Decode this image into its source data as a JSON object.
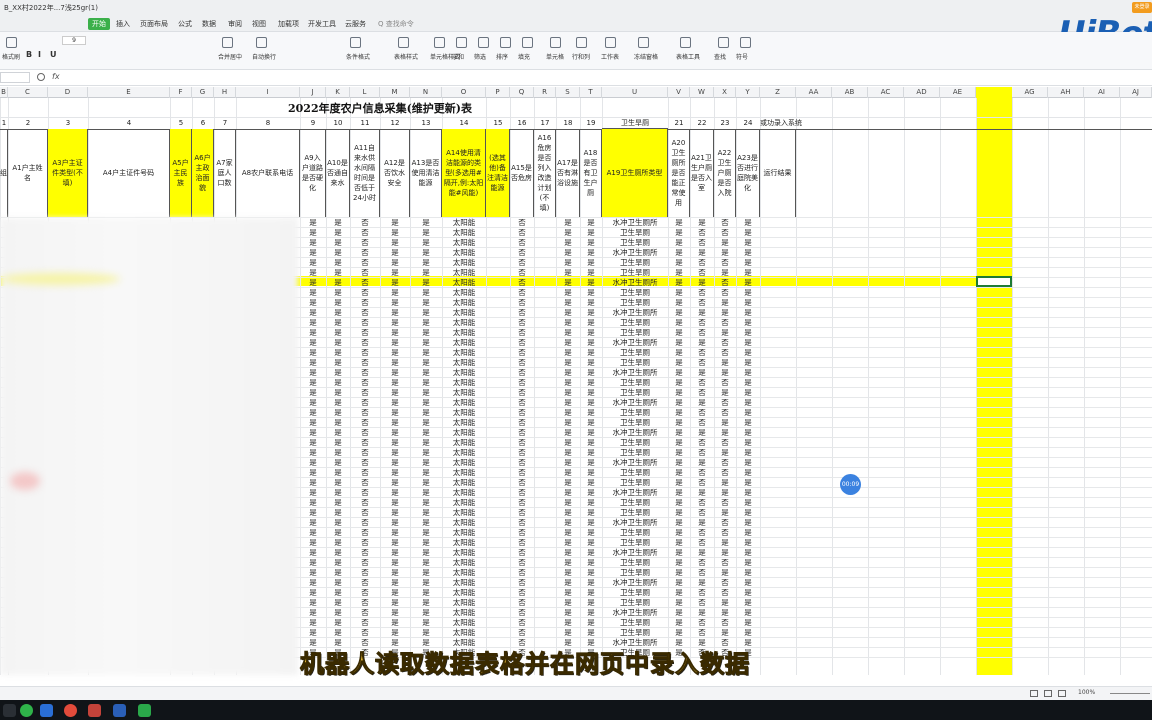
{
  "window": {
    "doc_tab": "B_XX村2022年...7浅25gr(1)",
    "corner_badge": "未登录"
  },
  "menu": {
    "items": [
      "开始",
      "插入",
      "页面布局",
      "公式",
      "数据",
      "审阅",
      "视图",
      "加载项",
      "开发工具",
      "云服务"
    ],
    "active": "开始",
    "search": "查找命令"
  },
  "ribbon": {
    "labels": [
      "格式刷",
      "合并居中",
      "自动换行",
      "条件格式",
      "表格样式",
      "单元格样式",
      "求和",
      "筛选",
      "排序",
      "填充",
      "单元格",
      "行和列",
      "工作表",
      "冻结窗格",
      "表格工具",
      "查找",
      "符号"
    ],
    "font_size": "9"
  },
  "formula_bar": {
    "name_box": "",
    "fx": "fx"
  },
  "logo": "UiBot",
  "columns": [
    "B",
    "C",
    "D",
    "E",
    "F",
    "G",
    "H",
    "I",
    "J",
    "K",
    "L",
    "M",
    "N",
    "O",
    "P",
    "Q",
    "R",
    "S",
    "T",
    "U",
    "V",
    "W",
    "X",
    "Y",
    "Z",
    "AA",
    "AB",
    "AC",
    "AD",
    "AE",
    "AF",
    "AG",
    "AH",
    "AI",
    "AJ"
  ],
  "sheet": {
    "title": "2022年度农户信息采集(维护更新)表",
    "number_row": [
      "1",
      "2",
      "3",
      "4",
      "5",
      "6",
      "7",
      "8",
      "9",
      "10",
      "11",
      "12",
      "13",
      "14",
      "15",
      "16",
      "17",
      "18",
      "19",
      "卫生旱厕",
      "21",
      "22",
      "23",
      "24",
      "或功录入系统"
    ],
    "headers": [
      {
        "text": "组",
        "yellow": false
      },
      {
        "text": "A1户主姓名",
        "yellow": false
      },
      {
        "text": "A3户主证件类型(不填)",
        "yellow": true
      },
      {
        "text": "A4户主证件号码",
        "yellow": false
      },
      {
        "text": "A5户主民族",
        "yellow": true
      },
      {
        "text": "A6户主政治面貌",
        "yellow": true
      },
      {
        "text": "A7家庭人口数",
        "yellow": false
      },
      {
        "text": "A8农户联系电话",
        "yellow": false
      },
      {
        "text": "A9入户道路是否硬化",
        "yellow": false
      },
      {
        "text": "A10是否通自来水",
        "yellow": false
      },
      {
        "text": "A11自来水供水间隔时间是否低于24小时",
        "yellow": false
      },
      {
        "text": "A12是否饮水安全",
        "yellow": false
      },
      {
        "text": "A13是否使用清洁能源",
        "yellow": false
      },
      {
        "text": "A14使用清洁能源的类型(多选用#隔开,例:太阳能#风能)",
        "yellow": true
      },
      {
        "text": "(选其他)备注清洁能源",
        "yellow": true
      },
      {
        "text": "A15是否危房",
        "yellow": false
      },
      {
        "text": "A16危房是否列入改造计划(不填)",
        "yellow": false
      },
      {
        "text": "A17是否有淋浴设施",
        "yellow": false
      },
      {
        "text": "A18是否有卫生户厕",
        "yellow": false
      },
      {
        "text": "A19卫生厕所类型",
        "yellow": true
      },
      {
        "text": "A20卫生厕所是否能正常使用",
        "yellow": false
      },
      {
        "text": "A21卫生户厕是否入室",
        "yellow": false
      },
      {
        "text": "A22卫生户厕是否入院",
        "yellow": false
      },
      {
        "text": "A23是否进行庭院美化",
        "yellow": false
      },
      {
        "text": "运行结果",
        "yellow": false
      }
    ],
    "row_pattern": [
      [
        "是",
        "是",
        "否",
        "是",
        "是",
        "太阳能",
        "",
        "否",
        "",
        "是",
        "是",
        "水冲卫生厕所",
        "是",
        "是",
        "否",
        "是"
      ],
      [
        "是",
        "是",
        "否",
        "是",
        "是",
        "太阳能",
        "",
        "否",
        "",
        "是",
        "是",
        "卫生旱厕",
        "是",
        "否",
        "否",
        "是"
      ],
      [
        "是",
        "是",
        "否",
        "是",
        "是",
        "太阳能",
        "",
        "否",
        "",
        "是",
        "是",
        "卫生旱厕",
        "是",
        "否",
        "是",
        "是"
      ],
      [
        "是",
        "是",
        "否",
        "是",
        "是",
        "太阳能",
        "",
        "否",
        "",
        "是",
        "是",
        "水冲卫生厕所",
        "是",
        "是",
        "是",
        "是"
      ],
      [
        "是",
        "是",
        "否",
        "是",
        "是",
        "太阳能",
        "",
        "否",
        "",
        "是",
        "是",
        "卫生旱厕",
        "是",
        "否",
        "否",
        "是"
      ],
      [
        "是",
        "是",
        "否",
        "是",
        "是",
        "太阳能",
        "",
        "否",
        "",
        "是",
        "是",
        "卫生旱厕",
        "是",
        "否",
        "是",
        "是"
      ]
    ],
    "row_count": 44
  },
  "timer": "00:09",
  "subtitle": "机器人读取数据表格并在网页中录入数据",
  "status": {
    "zoom": "100%"
  }
}
